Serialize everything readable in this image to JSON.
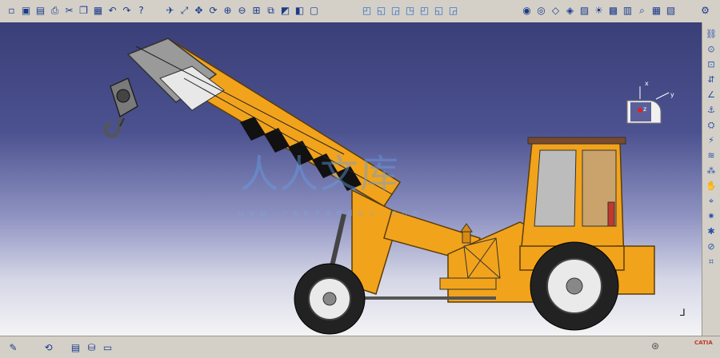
{
  "toolbar_top": {
    "groups": [
      {
        "name": "file-tools",
        "icons": [
          "new-icon",
          "open-icon",
          "save-icon",
          "print-icon",
          "cut-icon",
          "copy-icon",
          "paste-icon",
          "undo-icon",
          "redo-icon",
          "whats-this-icon"
        ]
      },
      {
        "name": "view-tools",
        "icons": [
          "fly-icon",
          "fit-all-icon",
          "pan-icon",
          "rotate-icon",
          "zoom-in-icon",
          "zoom-out-icon",
          "normal-view-icon",
          "multi-view-icon",
          "quick-view-icon",
          "hide-show-icon",
          "swap-visible-icon"
        ]
      },
      {
        "name": "view-mode-tools",
        "icons": [
          "iso-view-icon",
          "front-view-icon",
          "back-view-icon",
          "left-view-icon",
          "right-view-icon",
          "top-view-icon",
          "bottom-view-icon"
        ]
      },
      {
        "name": "render-tools",
        "icons": [
          "shading-icon",
          "shading-edges-icon",
          "wireframe-icon",
          "hidden-lines-icon",
          "material-icon",
          "lighting-icon",
          "depth-effect-icon",
          "ground-icon",
          "magnifier-icon",
          "grid-icon",
          "mesh-icon"
        ]
      },
      {
        "name": "misc-tools",
        "icons": [
          "settings-icon"
        ]
      }
    ]
  },
  "toolbar_right": {
    "icons": [
      "assembly-constraint-icon",
      "coincidence-icon",
      "contact-icon",
      "offset-icon",
      "angle-icon",
      "fix-icon",
      "fix-together-icon",
      "quick-constraint-icon",
      "flexible-icon",
      "reuse-pattern-icon",
      "manipulate-icon",
      "snap-icon",
      "explode-icon",
      "clash-icon",
      "section-icon",
      "measure-icon"
    ]
  },
  "toolbar_bottom": {
    "icons": [
      "sketch-icon",
      "part-design-icon",
      "catalog-icon",
      "analysis-icon",
      "properties-icon"
    ]
  },
  "compass": {
    "x_label": "x",
    "y_label": "y",
    "z_label": "z"
  },
  "watermark": {
    "text": "人人文库",
    "url": "www.renrendoc.com"
  },
  "brand": {
    "logo_text": "CATIA",
    "accent": "#f2a31c",
    "viewport_top": "#3a3f78"
  }
}
